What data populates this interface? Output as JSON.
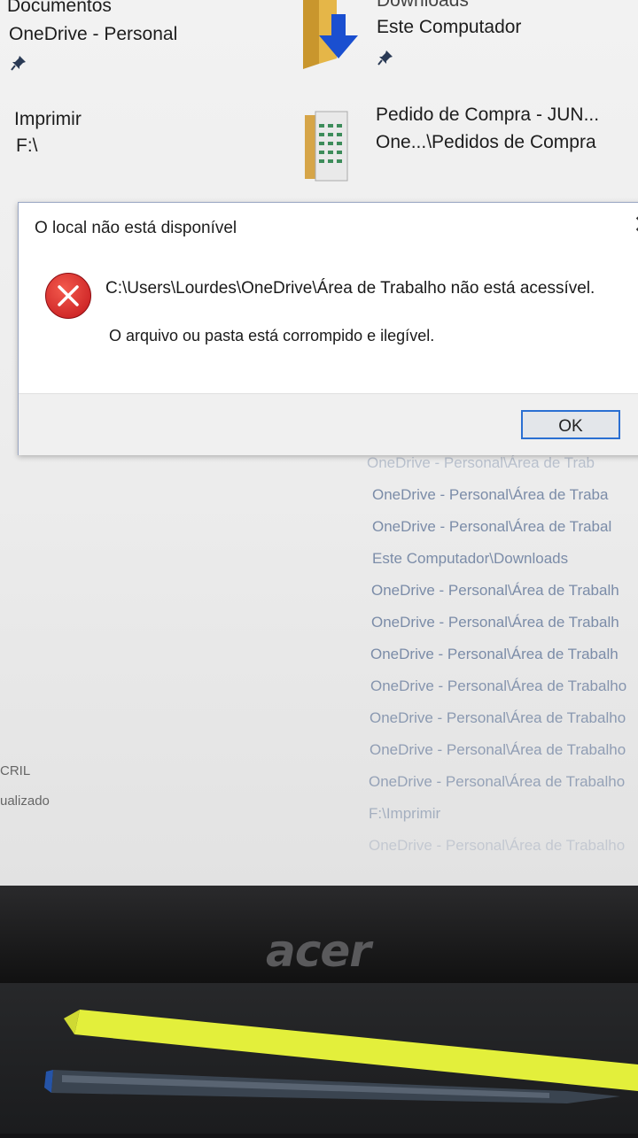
{
  "quick_access": {
    "item1": {
      "name": "Documentos",
      "location": "OneDrive - Personal"
    },
    "item2": {
      "name": "Downloads",
      "location": "Este Computador"
    },
    "item3": {
      "name": "Imprimir",
      "location": "F:\\"
    },
    "item4": {
      "name": "Pedido de Compra - JUN...",
      "location": "One...\\Pedidos de Compra"
    }
  },
  "recent_paths": [
    "OneDrive - Personal\\Área de Trab",
    "OneDrive - Personal\\Área de Traba",
    "OneDrive - Personal\\Área de Trabal",
    "Este Computador\\Downloads",
    "OneDrive - Personal\\Área de Trabalh",
    "OneDrive - Personal\\Área de Trabalh",
    "OneDrive - Personal\\Área de Trabalh",
    "OneDrive - Personal\\Área de Trabalho",
    "OneDrive - Personal\\Área de Trabalho",
    "OneDrive - Personal\\Área de Trabalho",
    "OneDrive - Personal\\Área de Trabalho",
    "F:\\Imprimir",
    "OneDrive - Personal\\Área de Trabalho"
  ],
  "left_fragments": {
    "line1": "CRIL",
    "line2": "ualizado"
  },
  "dialog": {
    "title": "O local não está disponível",
    "close": "✕",
    "message": "C:\\Users\\Lourdes\\OneDrive\\Área de Trabalho não está acessível.",
    "detail": "O arquivo ou pasta está corrompido e ilegível.",
    "ok_label": "OK"
  },
  "monitor": {
    "brand": "acer"
  },
  "icons": {
    "error": "error-x-icon",
    "pin": "pin-icon",
    "folder": "folder-icon",
    "download": "download-arrow-icon"
  },
  "colors": {
    "error_red": "#d8262c",
    "ok_border": "#2a6fd2",
    "recent_text": "#7b8ca8"
  }
}
